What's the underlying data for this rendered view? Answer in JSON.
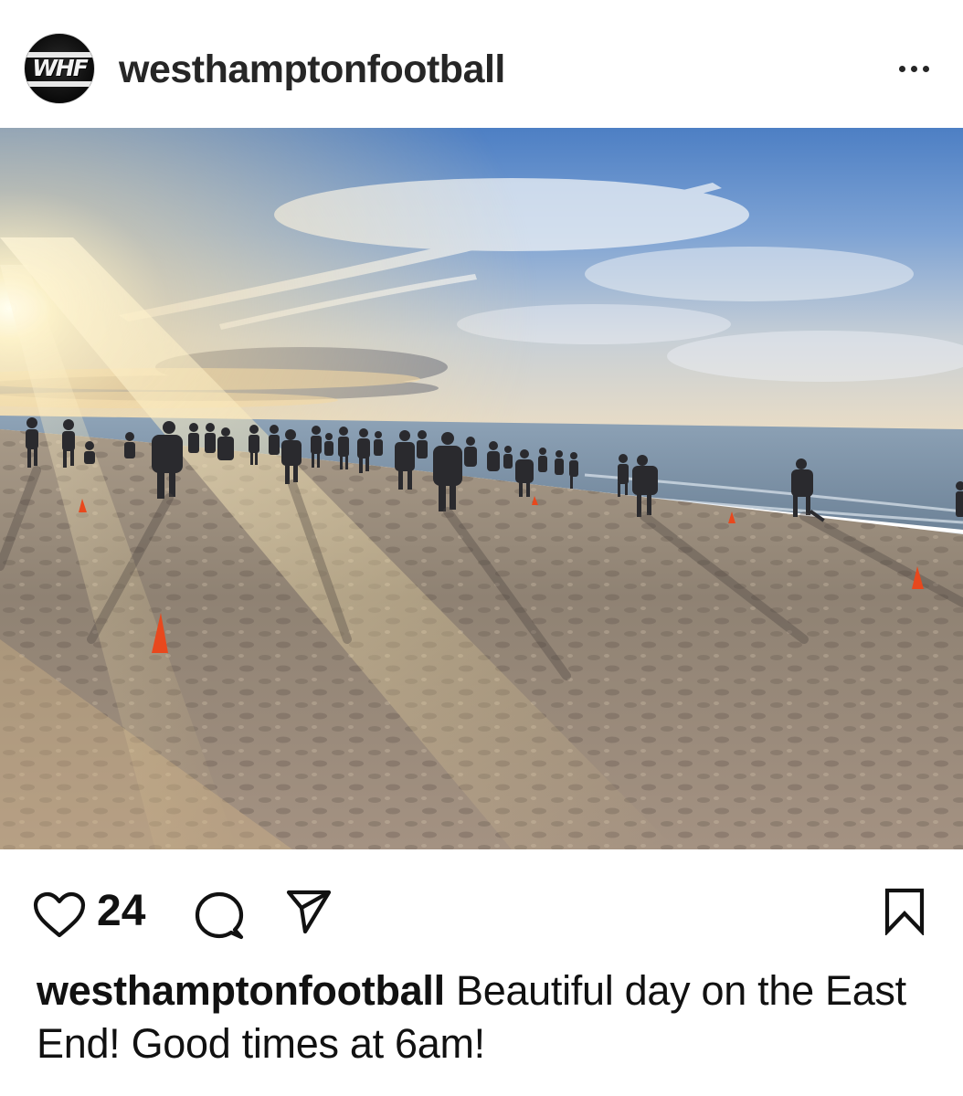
{
  "post": {
    "avatar_text": "WHF",
    "username": "westhamptonfootball",
    "more_label": "More options",
    "like_count": "24",
    "caption_user": "westhamptonfootball",
    "caption_text": "Beautiful day on the East End! Good times at 6am!"
  },
  "icons": {
    "more": "ellipsis-icon",
    "like": "heart-icon",
    "comment": "comment-bubble-icon",
    "share": "paper-plane-icon",
    "save": "bookmark-icon"
  },
  "colors": {
    "text": "#262626",
    "background": "#ffffff"
  }
}
